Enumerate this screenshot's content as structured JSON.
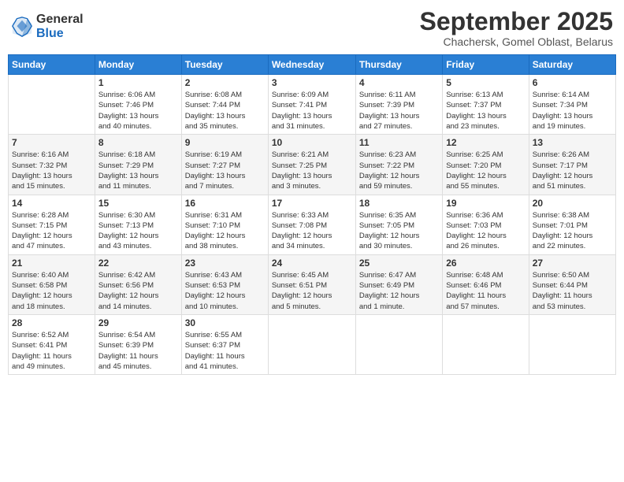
{
  "header": {
    "logo_general": "General",
    "logo_blue": "Blue",
    "month_title": "September 2025",
    "location": "Chachersk, Gomel Oblast, Belarus"
  },
  "weekdays": [
    "Sunday",
    "Monday",
    "Tuesday",
    "Wednesday",
    "Thursday",
    "Friday",
    "Saturday"
  ],
  "weeks": [
    [
      {
        "day": "",
        "info": ""
      },
      {
        "day": "1",
        "info": "Sunrise: 6:06 AM\nSunset: 7:46 PM\nDaylight: 13 hours\nand 40 minutes."
      },
      {
        "day": "2",
        "info": "Sunrise: 6:08 AM\nSunset: 7:44 PM\nDaylight: 13 hours\nand 35 minutes."
      },
      {
        "day": "3",
        "info": "Sunrise: 6:09 AM\nSunset: 7:41 PM\nDaylight: 13 hours\nand 31 minutes."
      },
      {
        "day": "4",
        "info": "Sunrise: 6:11 AM\nSunset: 7:39 PM\nDaylight: 13 hours\nand 27 minutes."
      },
      {
        "day": "5",
        "info": "Sunrise: 6:13 AM\nSunset: 7:37 PM\nDaylight: 13 hours\nand 23 minutes."
      },
      {
        "day": "6",
        "info": "Sunrise: 6:14 AM\nSunset: 7:34 PM\nDaylight: 13 hours\nand 19 minutes."
      }
    ],
    [
      {
        "day": "7",
        "info": "Sunrise: 6:16 AM\nSunset: 7:32 PM\nDaylight: 13 hours\nand 15 minutes."
      },
      {
        "day": "8",
        "info": "Sunrise: 6:18 AM\nSunset: 7:29 PM\nDaylight: 13 hours\nand 11 minutes."
      },
      {
        "day": "9",
        "info": "Sunrise: 6:19 AM\nSunset: 7:27 PM\nDaylight: 13 hours\nand 7 minutes."
      },
      {
        "day": "10",
        "info": "Sunrise: 6:21 AM\nSunset: 7:25 PM\nDaylight: 13 hours\nand 3 minutes."
      },
      {
        "day": "11",
        "info": "Sunrise: 6:23 AM\nSunset: 7:22 PM\nDaylight: 12 hours\nand 59 minutes."
      },
      {
        "day": "12",
        "info": "Sunrise: 6:25 AM\nSunset: 7:20 PM\nDaylight: 12 hours\nand 55 minutes."
      },
      {
        "day": "13",
        "info": "Sunrise: 6:26 AM\nSunset: 7:17 PM\nDaylight: 12 hours\nand 51 minutes."
      }
    ],
    [
      {
        "day": "14",
        "info": "Sunrise: 6:28 AM\nSunset: 7:15 PM\nDaylight: 12 hours\nand 47 minutes."
      },
      {
        "day": "15",
        "info": "Sunrise: 6:30 AM\nSunset: 7:13 PM\nDaylight: 12 hours\nand 43 minutes."
      },
      {
        "day": "16",
        "info": "Sunrise: 6:31 AM\nSunset: 7:10 PM\nDaylight: 12 hours\nand 38 minutes."
      },
      {
        "day": "17",
        "info": "Sunrise: 6:33 AM\nSunset: 7:08 PM\nDaylight: 12 hours\nand 34 minutes."
      },
      {
        "day": "18",
        "info": "Sunrise: 6:35 AM\nSunset: 7:05 PM\nDaylight: 12 hours\nand 30 minutes."
      },
      {
        "day": "19",
        "info": "Sunrise: 6:36 AM\nSunset: 7:03 PM\nDaylight: 12 hours\nand 26 minutes."
      },
      {
        "day": "20",
        "info": "Sunrise: 6:38 AM\nSunset: 7:01 PM\nDaylight: 12 hours\nand 22 minutes."
      }
    ],
    [
      {
        "day": "21",
        "info": "Sunrise: 6:40 AM\nSunset: 6:58 PM\nDaylight: 12 hours\nand 18 minutes."
      },
      {
        "day": "22",
        "info": "Sunrise: 6:42 AM\nSunset: 6:56 PM\nDaylight: 12 hours\nand 14 minutes."
      },
      {
        "day": "23",
        "info": "Sunrise: 6:43 AM\nSunset: 6:53 PM\nDaylight: 12 hours\nand 10 minutes."
      },
      {
        "day": "24",
        "info": "Sunrise: 6:45 AM\nSunset: 6:51 PM\nDaylight: 12 hours\nand 5 minutes."
      },
      {
        "day": "25",
        "info": "Sunrise: 6:47 AM\nSunset: 6:49 PM\nDaylight: 12 hours\nand 1 minute."
      },
      {
        "day": "26",
        "info": "Sunrise: 6:48 AM\nSunset: 6:46 PM\nDaylight: 11 hours\nand 57 minutes."
      },
      {
        "day": "27",
        "info": "Sunrise: 6:50 AM\nSunset: 6:44 PM\nDaylight: 11 hours\nand 53 minutes."
      }
    ],
    [
      {
        "day": "28",
        "info": "Sunrise: 6:52 AM\nSunset: 6:41 PM\nDaylight: 11 hours\nand 49 minutes."
      },
      {
        "day": "29",
        "info": "Sunrise: 6:54 AM\nSunset: 6:39 PM\nDaylight: 11 hours\nand 45 minutes."
      },
      {
        "day": "30",
        "info": "Sunrise: 6:55 AM\nSunset: 6:37 PM\nDaylight: 11 hours\nand 41 minutes."
      },
      {
        "day": "",
        "info": ""
      },
      {
        "day": "",
        "info": ""
      },
      {
        "day": "",
        "info": ""
      },
      {
        "day": "",
        "info": ""
      }
    ]
  ]
}
